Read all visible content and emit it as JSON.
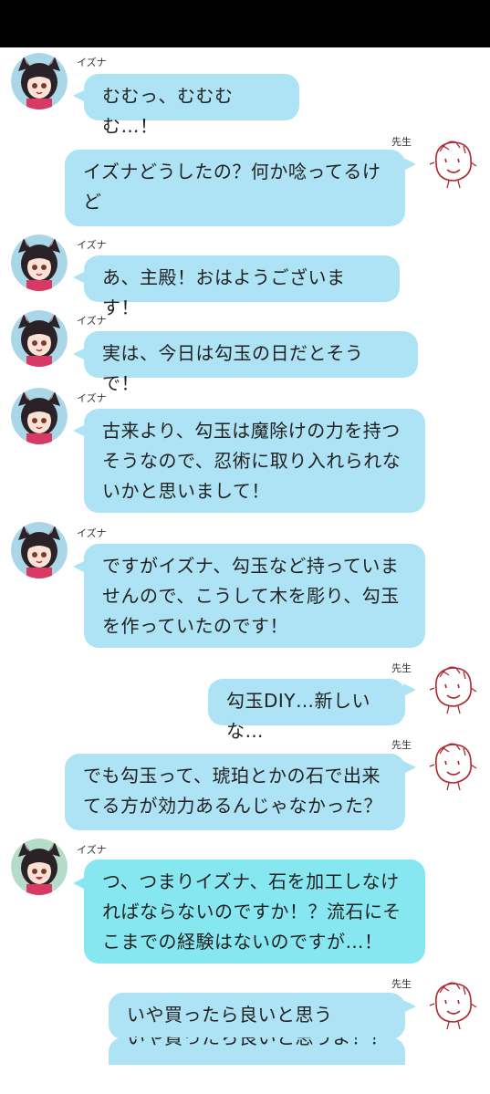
{
  "names": {
    "student": "イズナ",
    "teacher": "先生"
  },
  "messages": [
    {
      "from": "student",
      "lines": [
        "むむっ、むむむむ…！"
      ]
    },
    {
      "from": "teacher",
      "lines": [
        "イズナどうしたの？何か唸ってるけ",
        "ど"
      ]
    },
    {
      "from": "student",
      "lines": [
        "あ、主殿！おはようございます！"
      ]
    },
    {
      "from": "student",
      "lines": [
        "実は、今日は勾玉の日だとそうで！"
      ]
    },
    {
      "from": "student",
      "lines": [
        "古来より、勾玉は魔除けの力を持つ",
        "そうなので、忍術に取り入れられな",
        "いかと思いまして！"
      ]
    },
    {
      "from": "student",
      "lines": [
        "ですがイズナ、勾玉など持っていま",
        "せんので、こうして木を彫り、勾玉",
        "を作っていたのです！"
      ]
    },
    {
      "from": "teacher",
      "lines": [
        "勾玉DIY…新しいな…"
      ]
    },
    {
      "from": "teacher",
      "lines": [
        "でも勾玉って、琥珀とかの石で出来",
        "てる方が効力あるんじゃなかった？"
      ]
    },
    {
      "from": "student",
      "lines": [
        "つ、つまりイズナ、石を加工しなけ",
        "ればならないのですか！？流石にそ",
        "こまでの経験はないのですが…！"
      ]
    },
    {
      "from": "teacher",
      "lines": [
        "いや買ったら良いと思うよ！？"
      ]
    }
  ],
  "cut_message": "いや買ったら良いと思うよ！？",
  "colors": {
    "bubble": "#ade3f4",
    "bubble_alt": "#86e7f0",
    "face_stroke": "#b0272e"
  }
}
